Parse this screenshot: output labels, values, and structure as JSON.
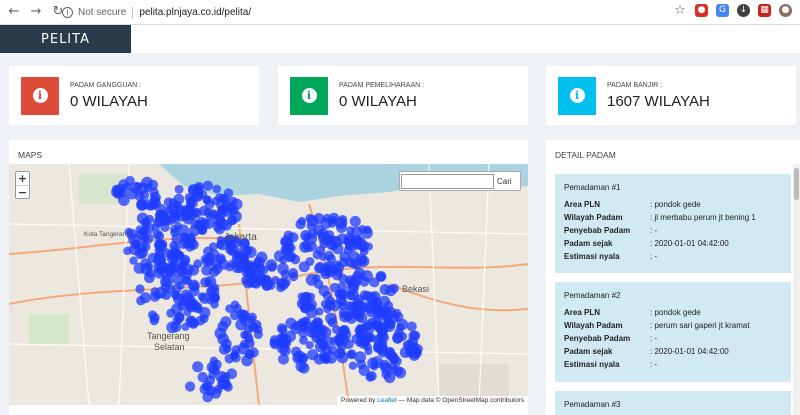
{
  "browser": {
    "security": "Not secure",
    "url": "pelita.plnjaya.co.id/pelita/"
  },
  "app": {
    "brand": "PELITA"
  },
  "stats": [
    {
      "label": "PADAM GANGGUAN :",
      "value": "0 WILAYAH",
      "color": "#dd4b39"
    },
    {
      "label": "PADAM PEMELIHARAAN :",
      "value": "0 WILAYAH",
      "color": "#00a65a"
    },
    {
      "label": "PADAM BANJIR :",
      "value": "1607 WILAYAH",
      "color": "#00c0ef"
    }
  ],
  "maps": {
    "title": "MAPS",
    "search_button": "Cari",
    "search_value": "",
    "places": [
      "Jakarta",
      "Bekasi",
      "Tangerang",
      "Selatan",
      "Kota Tangerang"
    ],
    "attribution": {
      "prefix": "Powered by ",
      "link": "Leaflet",
      "suffix": " — Map data © OpenStreetMap contributors"
    }
  },
  "detail": {
    "title": "DETAIL PADAM",
    "labels": {
      "area": "Area PLN",
      "wilayah": "Wilayah Padam",
      "penyebab": "Penyebab Padam",
      "sejak": "Padam sejak",
      "estimasi": "Estimasi nyala"
    },
    "items": [
      {
        "title": "Pemadaman #1",
        "area": ": pondok gede",
        "wilayah": ": jl merbabu perum jt bening 1",
        "penyebab": ": -",
        "sejak": ": 2020-01-01 04:42:00",
        "estimasi": ": -"
      },
      {
        "title": "Pemadaman #2",
        "area": ": pondok gede",
        "wilayah": ": perum sari gaperi jt kramat",
        "penyebab": ": -",
        "sejak": ": 2020-01-01 04:42:00",
        "estimasi": ": -"
      },
      {
        "title": "Pemadaman #3"
      }
    ]
  },
  "colors": {
    "marker": "#1f3cff",
    "header": "#293a4a"
  }
}
